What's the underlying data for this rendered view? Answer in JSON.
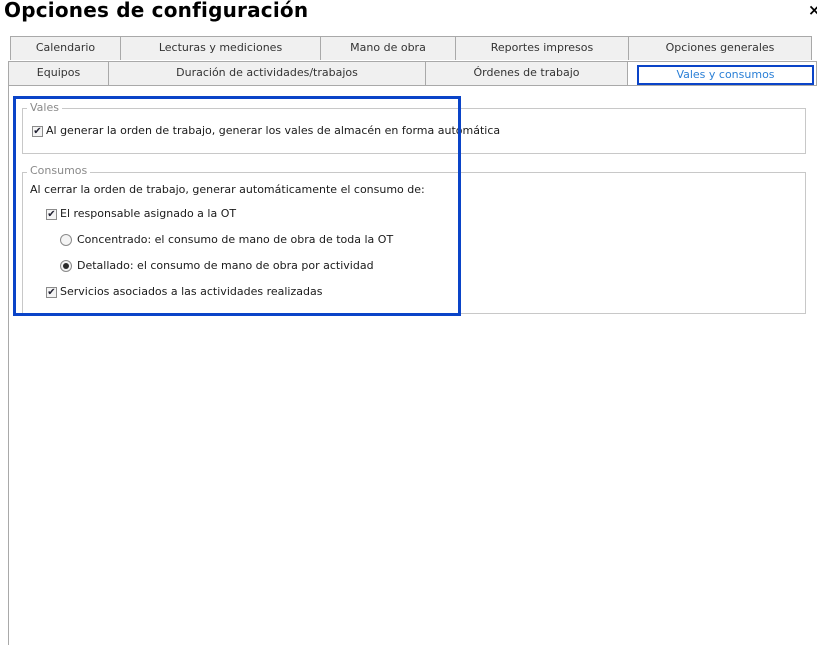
{
  "window": {
    "title": "Opciones de configuración",
    "close_glyph": "×"
  },
  "tabs": {
    "row1": [
      "Calendario",
      "Lecturas y mediciones",
      "Mano de obra",
      "Reportes impresos",
      "Opciones generales"
    ],
    "row2": [
      "Equipos",
      "Duración de actividades/trabajos",
      "Órdenes de trabajo",
      "Vales y consumos"
    ],
    "selected": "Vales y consumos"
  },
  "vales": {
    "legend": "Vales",
    "auto_vales": {
      "label": "Al generar la orden de trabajo, generar los vales de almacén en forma automática",
      "checked": true
    }
  },
  "consumos": {
    "legend": "Consumos",
    "intro": "Al cerrar la orden de trabajo, generar automáticamente el consumo de:",
    "responsable": {
      "label": "El responsable asignado a la OT",
      "checked": true
    },
    "concentrado": {
      "label": "Concentrado: el consumo de mano de obra de toda la OT",
      "selected": false
    },
    "detallado": {
      "label": "Detallado: el consumo de mano de obra por actividad",
      "selected": true
    },
    "servicios": {
      "label": "Servicios asociados a las actividades realizadas",
      "checked": true
    }
  },
  "colors": {
    "highlight": "#0a44c8",
    "selected_tab_text": "#2a7fd6",
    "tab_bg": "#f0f0f0"
  }
}
